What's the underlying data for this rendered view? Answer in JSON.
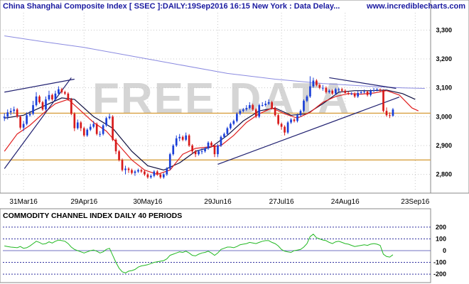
{
  "header": {
    "title": "China Shanghai Composite Index [ SSEC ]:DAILY:19Sep2016 16:15 New York : Data Delay...",
    "site": "www.incrediblecharts.com"
  },
  "watermark": "FREE DATA",
  "colors": {
    "up_candle": "#1a3fd8",
    "down_candle": "#d81a1a",
    "ma_long": "#8a8ae0",
    "ma_mid": "#101040",
    "ma_short": "#e02020",
    "support_line": "#d8a040",
    "trendline": "#202070",
    "cci": "#22b822",
    "band_line": "#3030a0",
    "zero_line": "#7070c0"
  },
  "chart_data": [
    {
      "type": "candlestick",
      "title": "China Shanghai Composite Index [ SSEC ]:DAILY:19Sep2016 16:15 New York : Data Delay...",
      "ylim": [
        2740,
        3360
      ],
      "y_ticks": [
        2800,
        2900,
        3000,
        3100,
        3200,
        3300
      ],
      "y_tick_labels": [
        "2,800",
        "2,900",
        "3,000",
        "3,100",
        "3,200",
        "3,300"
      ],
      "x_tick_labels": [
        {
          "label": "31Mar16",
          "index": 6
        },
        {
          "label": "29Apr16",
          "index": 25
        },
        {
          "label": "30May16",
          "index": 45
        },
        {
          "label": "29Jun16",
          "index": 67
        },
        {
          "label": "27Jul16",
          "index": 87
        },
        {
          "label": "24Aug16",
          "index": 107
        },
        {
          "label": "23Sep16",
          "index": 129
        }
      ],
      "x_count": 133,
      "close": [
        3000,
        3015,
        3020,
        3025,
        3000,
        2962,
        2975,
        3005,
        3010,
        3040,
        3070,
        3050,
        3025,
        3060,
        3075,
        3060,
        3080,
        3095,
        3085,
        3080,
        3060,
        3010,
        2960,
        2980,
        2960,
        2935,
        2955,
        2965,
        2975,
        2940,
        2940,
        2970,
        2995,
        3000,
        2920,
        2880,
        2850,
        2815,
        2820,
        2815,
        2805,
        2810,
        2815,
        2810,
        2800,
        2790,
        2795,
        2810,
        2800,
        2790,
        2800,
        2820,
        2870,
        2900,
        2925,
        2930,
        2920,
        2935,
        2900,
        2880,
        2870,
        2880,
        2880,
        2890,
        2910,
        2900,
        2870,
        2900,
        2930,
        2940,
        2960,
        2975,
        2985,
        3010,
        3020,
        3025,
        3030,
        3040,
        3025,
        3000,
        3040,
        3040,
        3045,
        3050,
        3030,
        3005,
        2975,
        2965,
        2945,
        2980,
        2990,
        2985,
        3005,
        3020,
        3055,
        3070,
        3105,
        3125,
        3110,
        3100,
        3100,
        3085,
        3090,
        3080,
        3095,
        3095,
        3090,
        3082,
        3080,
        3080,
        3070,
        3082,
        3085,
        3087,
        3075,
        3090,
        3092,
        3094,
        3091,
        3020,
        3005,
        3003,
        3025
      ],
      "open": [
        2995,
        3000,
        3015,
        3020,
        3025,
        3000,
        2962,
        2975,
        3005,
        3010,
        3040,
        3070,
        3050,
        3025,
        3060,
        3075,
        3060,
        3080,
        3095,
        3085,
        3080,
        3060,
        3010,
        2960,
        2980,
        2960,
        2935,
        2955,
        2965,
        2975,
        2940,
        2940,
        2970,
        2995,
        3000,
        2920,
        2880,
        2850,
        2815,
        2820,
        2815,
        2805,
        2810,
        2815,
        2810,
        2800,
        2790,
        2795,
        2810,
        2800,
        2790,
        2800,
        2820,
        2870,
        2900,
        2925,
        2930,
        2920,
        2935,
        2900,
        2880,
        2870,
        2880,
        2880,
        2890,
        2910,
        2900,
        2870,
        2900,
        2930,
        2940,
        2960,
        2975,
        2985,
        3010,
        3020,
        3025,
        3030,
        3040,
        3025,
        3000,
        3040,
        3040,
        3045,
        3050,
        3030,
        3005,
        2975,
        2965,
        2945,
        2980,
        2990,
        2985,
        3005,
        3020,
        3055,
        3070,
        3105,
        3125,
        3110,
        3100,
        3100,
        3085,
        3090,
        3080,
        3095,
        3095,
        3090,
        3082,
        3080,
        3080,
        3070,
        3082,
        3085,
        3087,
        3075,
        3090,
        3092,
        3094,
        3091,
        3020,
        3005,
        3003
      ],
      "high": [
        3012,
        3025,
        3030,
        3035,
        3030,
        3005,
        2985,
        3015,
        3020,
        3055,
        3085,
        3075,
        3055,
        3070,
        3090,
        3080,
        3090,
        3105,
        3100,
        3090,
        3085,
        3065,
        3015,
        2990,
        2985,
        2965,
        2960,
        2975,
        2985,
        2980,
        2950,
        2975,
        3000,
        3010,
        3005,
        2925,
        2885,
        2855,
        2830,
        2825,
        2820,
        2815,
        2820,
        2820,
        2815,
        2805,
        2800,
        2815,
        2815,
        2805,
        2805,
        2825,
        2875,
        2905,
        2935,
        2940,
        2935,
        2945,
        2940,
        2905,
        2885,
        2885,
        2890,
        2895,
        2915,
        2915,
        2905,
        2905,
        2935,
        2945,
        2965,
        2980,
        2990,
        3015,
        3025,
        3030,
        3040,
        3050,
        3045,
        3030,
        3045,
        3050,
        3055,
        3060,
        3055,
        3035,
        3010,
        2980,
        2970,
        2985,
        2995,
        2995,
        3010,
        3025,
        3060,
        3075,
        3140,
        3135,
        3130,
        3115,
        3110,
        3105,
        3095,
        3095,
        3100,
        3100,
        3100,
        3095,
        3088,
        3085,
        3085,
        3090,
        3092,
        3094,
        3090,
        3095,
        3100,
        3100,
        3098,
        3095,
        3032,
        3015,
        3030
      ],
      "low": [
        2985,
        2990,
        3005,
        3010,
        2995,
        2955,
        2950,
        2970,
        3000,
        3005,
        3035,
        3045,
        3020,
        3020,
        3055,
        3055,
        3055,
        3075,
        3080,
        3075,
        3055,
        3005,
        2950,
        2955,
        2950,
        2930,
        2930,
        2950,
        2960,
        2935,
        2930,
        2935,
        2965,
        2990,
        2915,
        2870,
        2845,
        2810,
        2800,
        2805,
        2800,
        2795,
        2805,
        2805,
        2795,
        2785,
        2785,
        2790,
        2795,
        2785,
        2785,
        2795,
        2815,
        2865,
        2895,
        2915,
        2915,
        2915,
        2895,
        2870,
        2860,
        2865,
        2870,
        2875,
        2885,
        2895,
        2860,
        2860,
        2895,
        2925,
        2935,
        2955,
        2970,
        2980,
        3005,
        3015,
        3020,
        3025,
        3020,
        2995,
        2995,
        3035,
        3035,
        3040,
        3025,
        3000,
        2970,
        2955,
        2935,
        2940,
        2975,
        2980,
        2980,
        3000,
        3015,
        3050,
        3065,
        3100,
        3105,
        3095,
        3090,
        3080,
        3080,
        3075,
        3075,
        3085,
        3085,
        3080,
        3075,
        3075,
        3065,
        3065,
        3078,
        3080,
        3070,
        3070,
        3085,
        3088,
        3085,
        3015,
        3000,
        2995,
        3000
      ],
      "support_levels": [
        3012,
        2850
      ],
      "series": [
        {
          "name": "",
          "kind": "ma_long",
          "points": [
            [
              0,
              3280
            ],
            [
              12,
              3260
            ],
            [
              25,
              3240
            ],
            [
              40,
              3210
            ],
            [
              55,
              3180
            ],
            [
              70,
              3150
            ],
            [
              85,
              3130
            ],
            [
              100,
              3115
            ],
            [
              115,
              3105
            ],
            [
              125,
              3100
            ],
            [
              132,
              3098
            ]
          ]
        },
        {
          "name": "",
          "kind": "ma_mid",
          "points": [
            [
              0,
              2995
            ],
            [
              6,
              3005
            ],
            [
              12,
              3035
            ],
            [
              18,
              3065
            ],
            [
              22,
              3060
            ],
            [
              28,
              3000
            ],
            [
              34,
              2960
            ],
            [
              40,
              2880
            ],
            [
              45,
              2830
            ],
            [
              50,
              2815
            ],
            [
              55,
              2840
            ],
            [
              60,
              2880
            ],
            [
              65,
              2895
            ],
            [
              70,
              2935
            ],
            [
              75,
              2985
            ],
            [
              80,
              3020
            ],
            [
              85,
              3030
            ],
            [
              90,
              3005
            ],
            [
              95,
              3010
            ],
            [
              100,
              3045
            ],
            [
              105,
              3085
            ],
            [
              110,
              3090
            ],
            [
              115,
              3090
            ],
            [
              120,
              3092
            ],
            [
              125,
              3080
            ],
            [
              129,
              3060
            ]
          ]
        },
        {
          "name": "",
          "kind": "ma_short",
          "points": [
            [
              0,
              2880
            ],
            [
              4,
              2940
            ],
            [
              8,
              2970
            ],
            [
              12,
              3010
            ],
            [
              16,
              3045
            ],
            [
              20,
              3060
            ],
            [
              24,
              3020
            ],
            [
              28,
              2980
            ],
            [
              32,
              2950
            ],
            [
              36,
              2900
            ],
            [
              40,
              2850
            ],
            [
              44,
              2815
            ],
            [
              48,
              2800
            ],
            [
              52,
              2815
            ],
            [
              56,
              2870
            ],
            [
              60,
              2890
            ],
            [
              64,
              2895
            ],
            [
              68,
              2900
            ],
            [
              72,
              2935
            ],
            [
              76,
              2980
            ],
            [
              80,
              3010
            ],
            [
              84,
              3030
            ],
            [
              88,
              3010
            ],
            [
              92,
              2995
            ],
            [
              96,
              3015
            ],
            [
              100,
              3050
            ],
            [
              104,
              3070
            ],
            [
              108,
              3080
            ],
            [
              112,
              3078
            ],
            [
              116,
              3082
            ],
            [
              120,
              3090
            ],
            [
              124,
              3075
            ],
            [
              128,
              3030
            ],
            [
              130,
              3020
            ]
          ]
        }
      ],
      "trendlines": [
        [
          [
            0,
            2820
          ],
          [
            21,
            3135
          ]
        ],
        [
          [
            0,
            3085
          ],
          [
            22,
            3130
          ]
        ],
        [
          [
            67,
            2835
          ],
          [
            124,
            3068
          ]
        ],
        [
          [
            102,
            3135
          ],
          [
            123,
            3098
          ]
        ]
      ]
    },
    {
      "type": "line",
      "title": "COMMODITY CHANNEL INDEX DAILY 40 PERIODS",
      "ylim": [
        -260,
        260
      ],
      "y_ticks": [
        200,
        100,
        0,
        -100,
        -200
      ],
      "y_tick_labels": [
        "200",
        "100",
        "0",
        "-100",
        "-200"
      ],
      "band_levels": [
        200,
        100,
        -100,
        -200
      ],
      "zero_level": 0,
      "series": [
        {
          "name": "",
          "values": [
            40,
            35,
            30,
            28,
            25,
            35,
            20,
            25,
            40,
            60,
            80,
            70,
            55,
            60,
            75,
            65,
            80,
            90,
            85,
            80,
            60,
            30,
            10,
            0,
            -10,
            -20,
            -10,
            0,
            5,
            -5,
            -20,
            -10,
            10,
            20,
            -40,
            -100,
            -150,
            -180,
            -190,
            -175,
            -170,
            -160,
            -140,
            -130,
            -125,
            -120,
            -110,
            -100,
            -95,
            -90,
            -85,
            -70,
            -40,
            -30,
            -20,
            -10,
            -15,
            -5,
            -20,
            -40,
            -45,
            -30,
            -20,
            -15,
            -5,
            -20,
            -40,
            -20,
            10,
            20,
            30,
            30,
            25,
            35,
            50,
            55,
            60,
            70,
            65,
            60,
            70,
            80,
            85,
            85,
            70,
            60,
            40,
            10,
            -5,
            -10,
            -15,
            0,
            5,
            10,
            30,
            60,
            120,
            140,
            110,
            100,
            90,
            85,
            70,
            60,
            75,
            80,
            70,
            60,
            55,
            45,
            35,
            40,
            45,
            50,
            45,
            55,
            60,
            55,
            45,
            -30,
            -50,
            -55,
            -35
          ]
        }
      ]
    }
  ]
}
